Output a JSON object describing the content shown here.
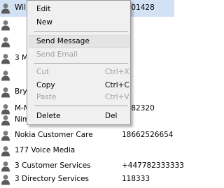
{
  "contacts": [
    {
      "name": "Wil",
      "phone": "7501428",
      "selected": true
    },
    {
      "name": "",
      "phone": ""
    },
    {
      "name": "",
      "phone": ""
    },
    {
      "name": "3 Me",
      "phone": ""
    },
    {
      "name": "",
      "phone": ""
    },
    {
      "name": "Bryn",
      "phone": ""
    },
    {
      "name": "M-M",
      "phone": "7782320"
    },
    {
      "name": "Nim",
      "phone": ""
    },
    {
      "name": "Nokia Customer Care",
      "phone": "18662526654"
    },
    {
      "name": "177 Voice Media",
      "phone": ""
    },
    {
      "name": "3 Customer Services",
      "phone": "+447782333333"
    },
    {
      "name": "3 Directory Services",
      "phone": "118333"
    }
  ],
  "context_menu": {
    "items": [
      {
        "label": "Edit",
        "shortcut": "",
        "disabled": false,
        "highlighted": false
      },
      {
        "label": "New",
        "shortcut": "",
        "disabled": false,
        "highlighted": false
      },
      {
        "separator": true
      },
      {
        "label": "Send Message",
        "shortcut": "",
        "disabled": false,
        "highlighted": true
      },
      {
        "label": "Send Email",
        "shortcut": "",
        "disabled": true,
        "highlighted": false
      },
      {
        "separator": true
      },
      {
        "label": "Cut",
        "shortcut": "Ctrl+X",
        "disabled": true,
        "highlighted": false
      },
      {
        "label": "Copy",
        "shortcut": "Ctrl+C",
        "disabled": false,
        "highlighted": false
      },
      {
        "label": "Paste",
        "shortcut": "Ctrl+V",
        "disabled": true,
        "highlighted": false
      },
      {
        "separator": true
      },
      {
        "label": "Delete",
        "shortcut": "Del",
        "disabled": false,
        "highlighted": false
      }
    ]
  },
  "icons": {
    "contact": "contact-person-icon"
  },
  "colors": {
    "selection": "#d3e1f5",
    "menu_background": "#f0f0f0",
    "disabled_text": "#a0a0a0"
  }
}
